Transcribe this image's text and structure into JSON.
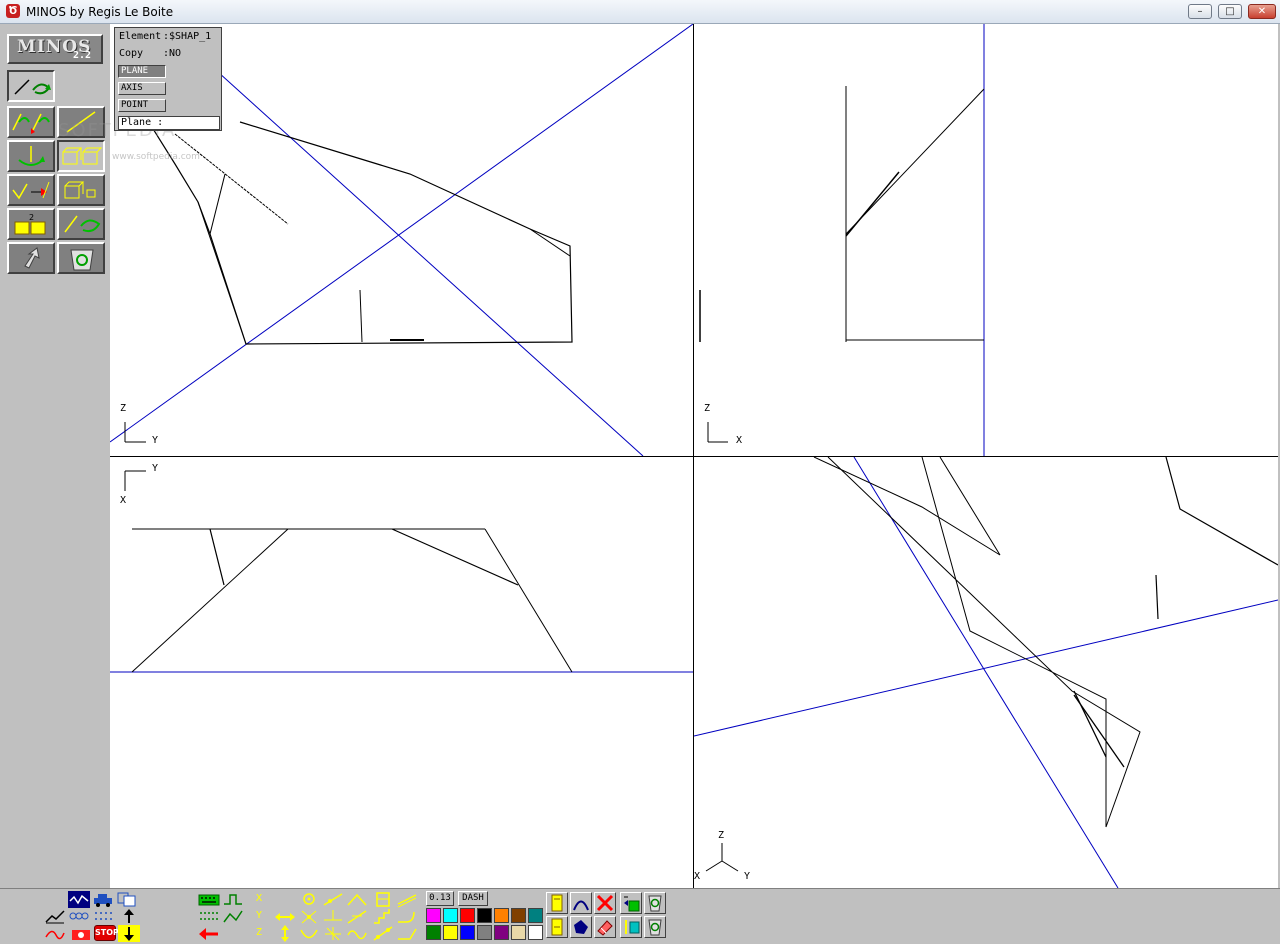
{
  "window": {
    "title": "MINOS by Regis Le Boite",
    "minimize_glyph": "–",
    "maximize_glyph": "□",
    "close_glyph": "✕"
  },
  "logo": {
    "name": "MINOS",
    "version": "2.2"
  },
  "element_panel": {
    "element_label": "Element",
    "element_value": ":$SHAP_1",
    "copy_label": "Copy",
    "copy_value": ":NO",
    "plane_button": "PLANE",
    "axis_button": "AXIS",
    "point_button": "POINT",
    "plane_field": "Plane    :"
  },
  "watermark": {
    "text": "SOFTPEDIA",
    "sub": "www.softpedia.com"
  },
  "viewports": {
    "top_left": {
      "axis_vertical": "Z",
      "axis_horizontal": "Y"
    },
    "top_right": {
      "axis_vertical": "Z",
      "axis_horizontal": "X"
    },
    "bottom_left": {
      "axis_vertical": "X",
      "axis_horizontal": "Y"
    },
    "bottom_right": {
      "axis_vertical": "Z",
      "axis_left": "X",
      "axis_right": "Y"
    }
  },
  "bottom_toolbar": {
    "line_width": "0.13",
    "line_style": "DASH",
    "coord_x": "X",
    "coord_y": "Y",
    "coord_z": "Z",
    "stop_label": "STOP",
    "colors_row1": [
      "#ff00ff",
      "#00ffff",
      "#ff0000",
      "#000000",
      "#ff8000",
      "#804000",
      "#008080"
    ],
    "colors_row2": [
      "#008000",
      "#ffff00",
      "#0000ff",
      "#808080",
      "#800080",
      "#e8d8a8",
      "#ffffff"
    ]
  },
  "colors": {
    "axis_blue": "#0000c0",
    "toolbar_gray": "#c0c0c0",
    "icon_yellow": "#ffff00"
  }
}
